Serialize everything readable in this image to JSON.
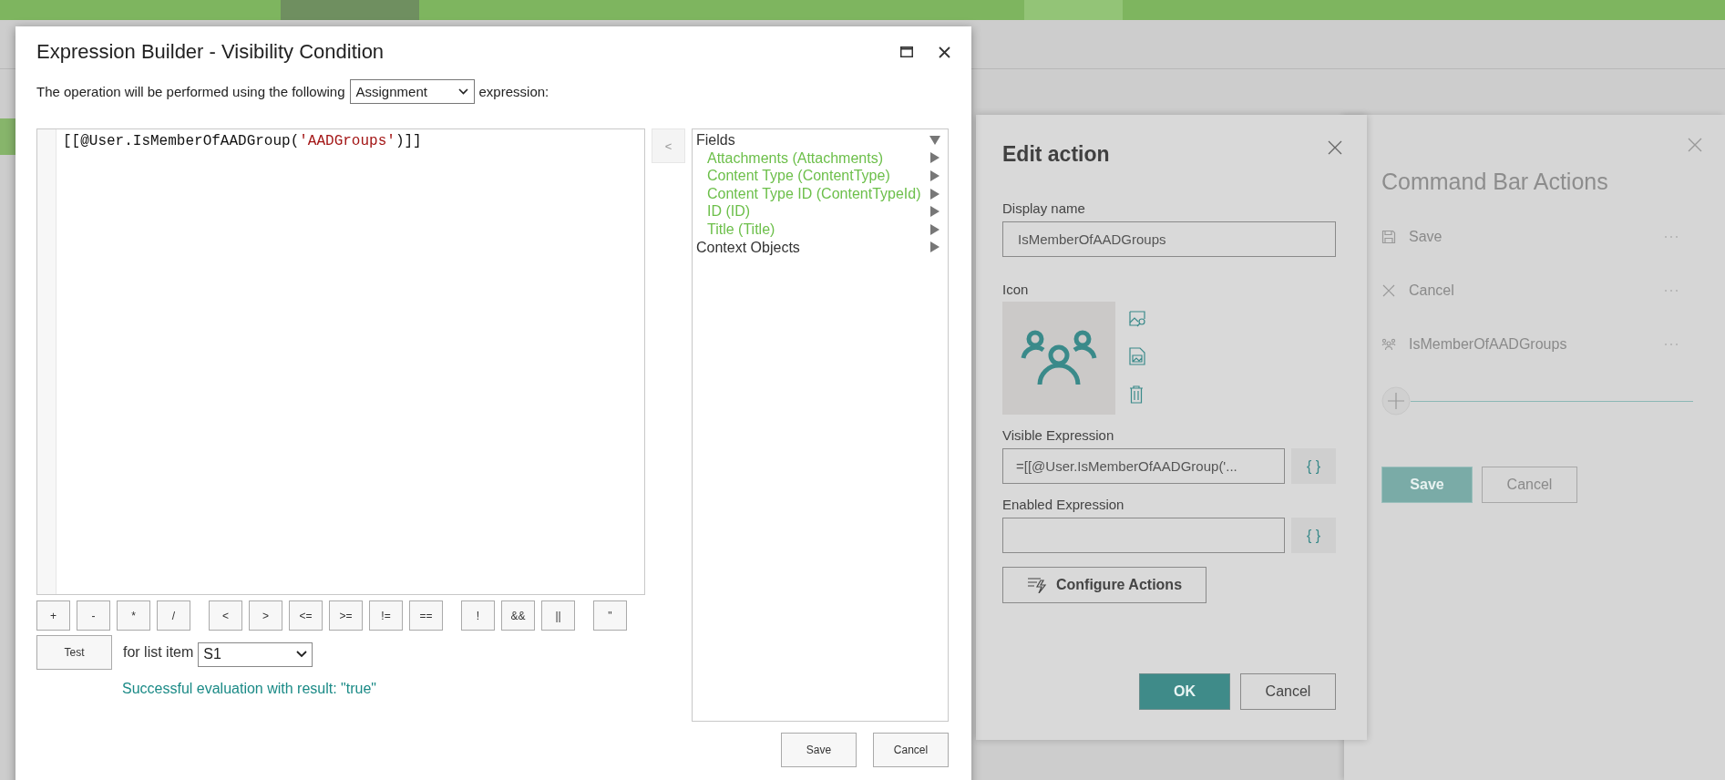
{
  "expression_dialog": {
    "title": "Expression Builder - Visibility Condition",
    "description_before": "The operation will be performed using the following",
    "mode": "Assignment",
    "description_after": "expression:",
    "code": [
      {
        "kind": "plain",
        "text": "[[@User.IsMemberOfAADGroup("
      },
      {
        "kind": "string",
        "text": "'AADGroups'"
      },
      {
        "kind": "plain",
        "text": ")]]"
      }
    ],
    "insert_button": "<",
    "tree": [
      {
        "label": "Fields",
        "expanded": true,
        "children": [
          {
            "label": "Attachments (Attachments)",
            "expanded": false
          },
          {
            "label": "Content Type (ContentType)",
            "expanded": false
          },
          {
            "label": "Content Type ID (ContentTypeId)",
            "expanded": false
          },
          {
            "label": "ID (ID)",
            "expanded": false
          },
          {
            "label": "Title (Title)",
            "expanded": false
          }
        ]
      },
      {
        "label": "Context Objects",
        "expanded": false
      }
    ],
    "operators": [
      [
        "+",
        "-",
        "*",
        "/"
      ],
      [
        "<",
        ">",
        "<=",
        ">=",
        "!=",
        "=="
      ],
      [
        "!",
        "&&",
        "||"
      ],
      [
        "\""
      ]
    ],
    "test_button": "Test",
    "list_item_label": "for list item",
    "list_item": "S1",
    "result": "Successful evaluation with result: \"true\"",
    "buttons": [
      "Save",
      "Cancel"
    ]
  },
  "edit_action": {
    "title": "Edit action",
    "display_name_label": "Display name",
    "display_name": "IsMemberOfAADGroups",
    "icon_label": "Icon",
    "expressions": [
      {
        "label": "Visible Expression",
        "value": "=[[@User.IsMemberOfAADGroup('...",
        "button": "{ }"
      },
      {
        "label": "Enabled Expression",
        "button": "{ }"
      }
    ],
    "configure_button": "Configure Actions",
    "ok_button": "OK",
    "cancel_button": "Cancel"
  },
  "command_bar_actions": {
    "title": "Command Bar Actions",
    "items": [
      {
        "kind": "save",
        "label": "Save"
      },
      {
        "kind": "cancel",
        "label": "Cancel"
      },
      {
        "kind": "group",
        "label": "IsMemberOfAADGroups"
      }
    ],
    "save_button": "Save",
    "cancel_button": "Cancel"
  }
}
